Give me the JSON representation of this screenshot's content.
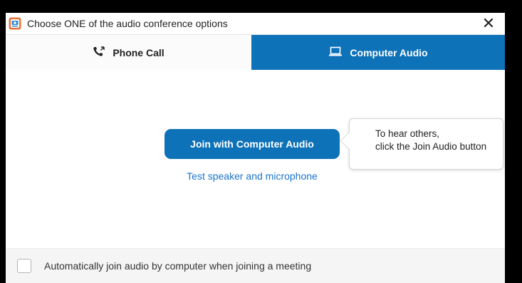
{
  "window": {
    "title": "Choose ONE of the audio conference options",
    "close_glyph": "✕",
    "app_icon": "zoom-app-icon"
  },
  "tabs": [
    {
      "label": "Phone Call",
      "icon": "phone-icon",
      "active": false
    },
    {
      "label": "Computer Audio",
      "icon": "laptop-icon",
      "active": true
    }
  ],
  "main": {
    "join_button_label": "Join with Computer Audio",
    "test_link_label": "Test speaker and microphone"
  },
  "tooltip": {
    "line1": "To hear others,",
    "line2": "click the Join Audio button"
  },
  "footer": {
    "checkbox_checked": false,
    "checkbox_label": "Automatically join audio by computer when joining a meeting"
  },
  "colors": {
    "accent": "#0e72b8",
    "link": "#1a73c8",
    "footer_bg": "#f5f5f5"
  }
}
